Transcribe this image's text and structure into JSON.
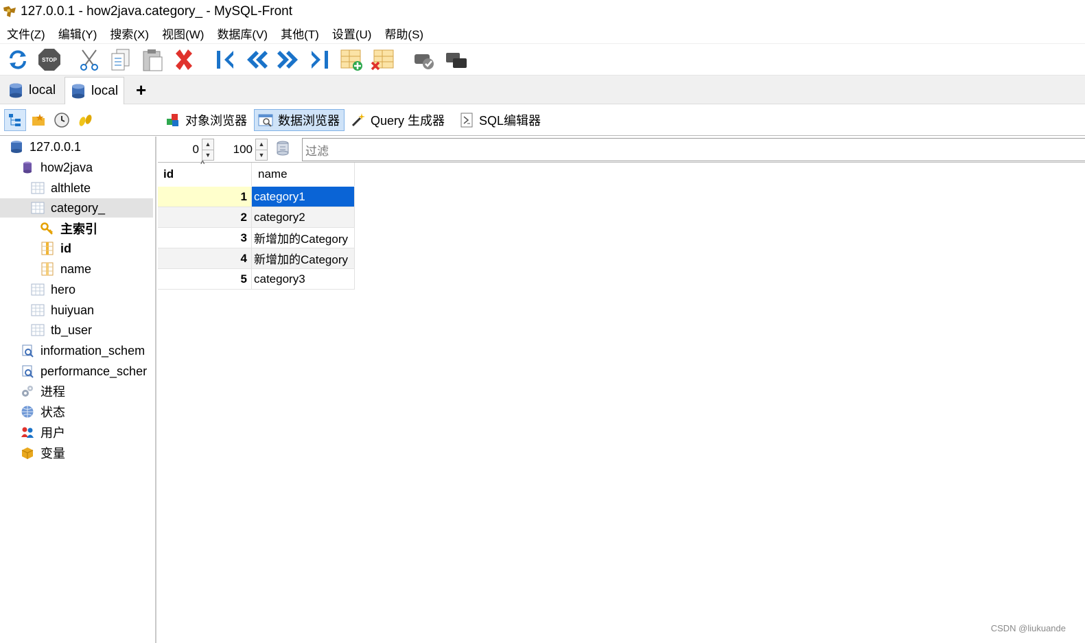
{
  "window": {
    "title": "127.0.0.1 - how2java.category_ - MySQL-Front"
  },
  "menu": [
    "文件(Z)",
    "编辑(Y)",
    "搜索(X)",
    "视图(W)",
    "数据库(V)",
    "其他(T)",
    "设置(U)",
    "帮助(S)"
  ],
  "toolbar": {
    "buttons": [
      "refresh-icon",
      "stop-icon",
      "cut-icon",
      "copy-icon",
      "paste-icon",
      "delete-icon",
      "first-record-icon",
      "previous-record-icon",
      "next-record-icon",
      "last-record-icon",
      "insert-row-icon",
      "delete-row-icon",
      "post-icon",
      "cancel-icon"
    ]
  },
  "tabs": {
    "items": [
      "local",
      "local"
    ],
    "add": "+"
  },
  "views": {
    "object_browser": "对象浏览器",
    "data_browser": "数据浏览器",
    "query_builder": "Query 生成器",
    "sql_editor": "SQL编辑器"
  },
  "tree": {
    "host": "127.0.0.1",
    "database": "how2java",
    "tables": {
      "althlete": "althlete",
      "category": "category_",
      "hero": "hero",
      "huiyuan": "huiyuan",
      "tb_user": "tb_user"
    },
    "category_children": {
      "primary_index": "主索引",
      "id": "id",
      "name": "name"
    },
    "information_schema": "information_schem",
    "performance_schema": "performance_scher",
    "processes": "进程",
    "status": "状态",
    "users": "用户",
    "variables": "变量"
  },
  "nav": {
    "offset": "0",
    "limit": "100",
    "filter_placeholder": "过滤"
  },
  "grid": {
    "columns": [
      "id",
      "name"
    ],
    "rows": [
      {
        "id": "1",
        "name": "category1"
      },
      {
        "id": "2",
        "name": "category2"
      },
      {
        "id": "3",
        "name": "新增加的Category"
      },
      {
        "id": "4",
        "name": "新增加的Category"
      },
      {
        "id": "5",
        "name": "category3"
      }
    ]
  },
  "watermark": "CSDN @liukuande"
}
